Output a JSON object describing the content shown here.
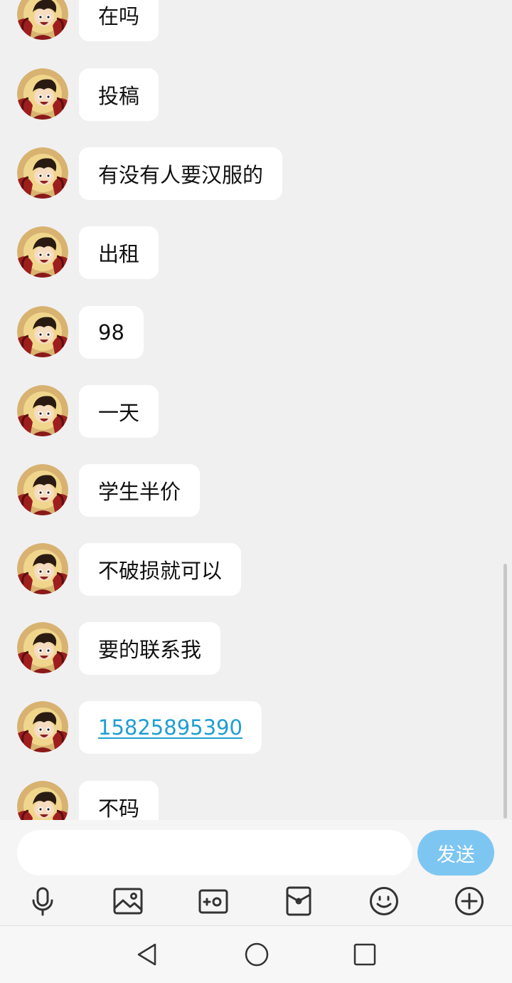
{
  "messages": [
    {
      "text": "在吗",
      "type": "text"
    },
    {
      "text": "投稿",
      "type": "text"
    },
    {
      "text": "有没有人要汉服的",
      "type": "text"
    },
    {
      "text": "出租",
      "type": "text"
    },
    {
      "text": "98",
      "type": "text"
    },
    {
      "text": "一天",
      "type": "text"
    },
    {
      "text": "学生半价",
      "type": "text"
    },
    {
      "text": "不破损就可以",
      "type": "text"
    },
    {
      "text": "要的联系我",
      "type": "text"
    },
    {
      "text": "15825895390",
      "type": "link"
    },
    {
      "text": "不码",
      "type": "text"
    }
  ],
  "composer": {
    "input_value": "",
    "input_placeholder": "",
    "send_label": "发送",
    "tools": [
      "microphone-icon",
      "image-icon",
      "camera-icon",
      "red-packet-icon",
      "emoji-icon",
      "plus-icon"
    ]
  },
  "navbar": {
    "buttons": [
      "back-triangle-icon",
      "home-circle-icon",
      "recents-square-icon"
    ]
  },
  "colors": {
    "chat_background": "#f0f0f0",
    "bubble": "#ffffff",
    "link": "#1f9ed2",
    "send_button": "#7ec6f2"
  }
}
